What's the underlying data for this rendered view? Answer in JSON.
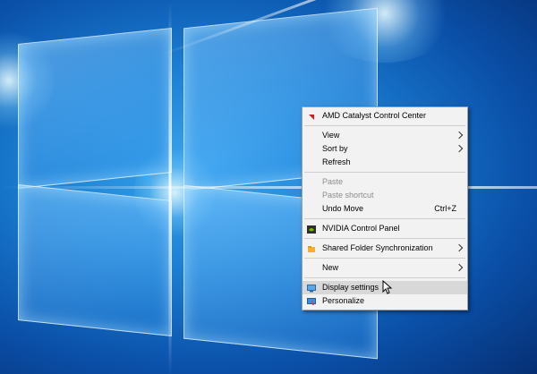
{
  "context_menu": {
    "items": [
      {
        "label": "AMD Catalyst Control Center",
        "icon": "amd-icon"
      },
      {
        "label": "View",
        "submenu": true
      },
      {
        "label": "Sort by",
        "submenu": true
      },
      {
        "label": "Refresh"
      },
      {
        "label": "Paste",
        "disabled": true
      },
      {
        "label": "Paste shortcut",
        "disabled": true
      },
      {
        "label": "Undo Move",
        "shortcut": "Ctrl+Z"
      },
      {
        "label": "NVIDIA Control Panel",
        "icon": "nvidia-icon"
      },
      {
        "label": "Shared Folder Synchronization",
        "icon": "folder-sync-icon",
        "submenu": true
      },
      {
        "label": "New",
        "submenu": true
      },
      {
        "label": "Display settings",
        "icon": "display-icon",
        "highlighted": true
      },
      {
        "label": "Personalize",
        "icon": "personalize-icon"
      }
    ]
  },
  "colors": {
    "accent": "#1a7fd2",
    "menu_bg": "#f2f2f2",
    "highlight": "#d8d8d8"
  }
}
